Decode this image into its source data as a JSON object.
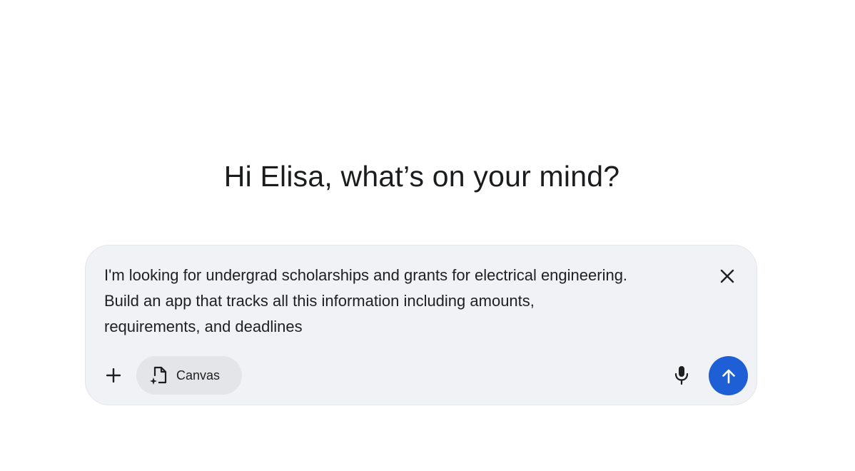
{
  "greeting": "Hi Elisa, what’s on your mind?",
  "composer": {
    "prompt_text": "I'm looking for undergrad scholarships and grants for electrical engineering.\nBuild an app that tracks all this information including amounts,\nrequirements, and deadlines",
    "tool_chip_label": "Canvas",
    "icons": {
      "clear": "close-icon",
      "add": "plus-icon",
      "canvas": "canvas-icon",
      "mic": "microphone-icon",
      "send": "arrow-up-icon"
    }
  },
  "colors": {
    "background": "#ffffff",
    "composer_bg": "#f0f2f5",
    "chip_bg": "#e3e5e8",
    "send_button": "#1f5fd6",
    "text": "#1f1f1f"
  }
}
